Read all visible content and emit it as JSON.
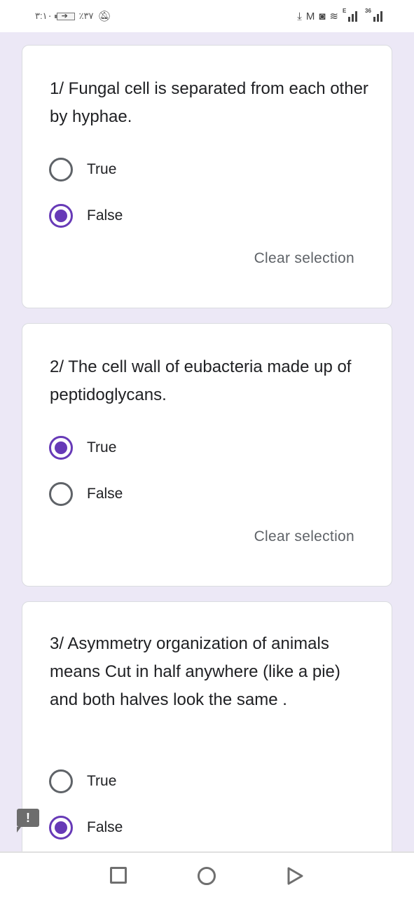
{
  "status_bar": {
    "time": "٣:١٠",
    "battery_percent": "٪٣٧",
    "left_icons": [
      "battery-charging-icon",
      "notifications-off-icon"
    ],
    "right_icons": [
      "download-icon",
      "gmail-icon",
      "instagram-icon",
      "wifi-icon",
      "signal-e-icon",
      "signal-3g-icon"
    ],
    "signal_1_label": "E",
    "signal_2_label": "36"
  },
  "questions": [
    {
      "number": 1,
      "text": "1/ Fungal cell is separated from each other by hyphae.",
      "options": [
        {
          "label": "True",
          "selected": false
        },
        {
          "label": "False",
          "selected": true
        }
      ],
      "clear_label": "Clear selection"
    },
    {
      "number": 2,
      "text": "2/ The cell wall of eubacteria made up of peptidoglycans.",
      "options": [
        {
          "label": "True",
          "selected": true
        },
        {
          "label": "False",
          "selected": false
        }
      ],
      "clear_label": "Clear selection"
    },
    {
      "number": 3,
      "text": "3/ Asymmetry organization of animals means Cut in half anywhere (like a pie) and both halves look the same .",
      "options": [
        {
          "label": "True",
          "selected": false
        },
        {
          "label": "False",
          "selected": true
        }
      ]
    }
  ],
  "feedback": {
    "glyph": "!"
  },
  "nav_bar": {
    "buttons": [
      "recents",
      "home",
      "back"
    ]
  },
  "colors": {
    "accent": "#673ab7",
    "background": "#ece8f6",
    "card": "#ffffff",
    "radio_unchecked": "#5f6368",
    "secondary_text": "#5f6368"
  }
}
